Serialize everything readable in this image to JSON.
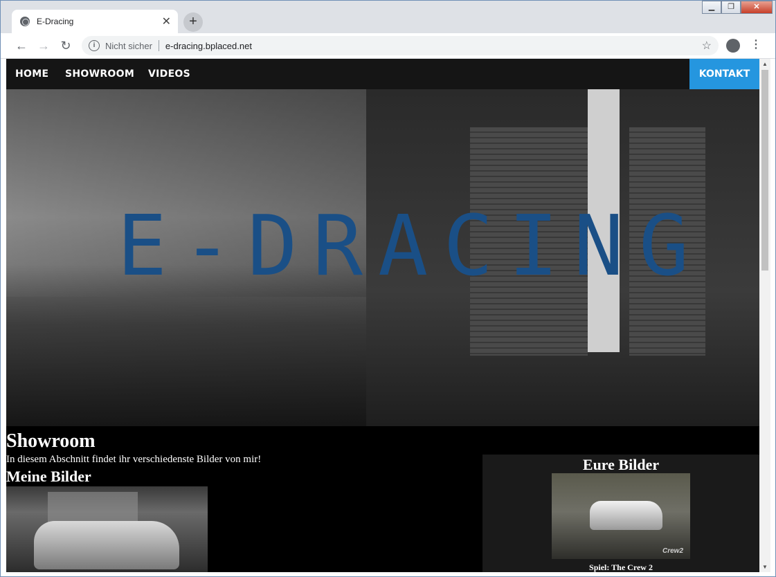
{
  "browser": {
    "tab_title": "E-Dracing",
    "tab_close": "✕",
    "new_tab": "+",
    "security_label": "Nicht sicher",
    "url": "e-dracing.bplaced.net"
  },
  "window_controls": {
    "minimize": "▁",
    "maximize": "❐",
    "close": "✕"
  },
  "site": {
    "nav": {
      "home": "HOME",
      "showroom": "SHOWROOM",
      "videos": "VIDEOS",
      "kontakt": "KONTAKT"
    },
    "hero_logo": "E-DRACING",
    "showroom_title": "Showroom",
    "showroom_text": "In diesem Abschnitt findet ihr verschiedenste Bilder von mir!",
    "meine_bilder_title": "Meine Bilder",
    "eure_bilder_title": "Eure Bilder",
    "eure_bilder_caption": "Spiel: The Crew 2",
    "eure_bilder_watermark": "Crew2"
  },
  "colors": {
    "nav_bg": "#151515",
    "kontakt_bg": "#2596df",
    "logo_color": "#1a4f86",
    "page_bg": "#000000"
  }
}
